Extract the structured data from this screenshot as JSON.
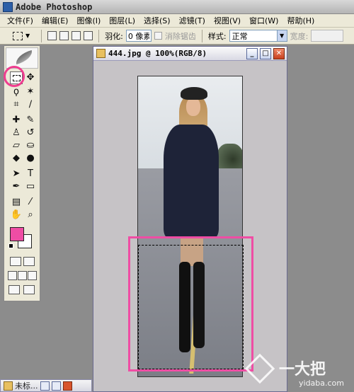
{
  "app": {
    "title": "Adobe Photoshop"
  },
  "menu": [
    {
      "label": "文件(F)"
    },
    {
      "label": "编辑(E)"
    },
    {
      "label": "图像(I)"
    },
    {
      "label": "图层(L)"
    },
    {
      "label": "选择(S)"
    },
    {
      "label": "滤镜(T)"
    },
    {
      "label": "视图(V)"
    },
    {
      "label": "窗口(W)"
    },
    {
      "label": "帮助(H)"
    }
  ],
  "options": {
    "feather_label": "羽化:",
    "feather_value": "0 像素",
    "antialias_label": "消除锯齿",
    "style_label": "样式:",
    "style_value": "正常",
    "width_label": "宽度:"
  },
  "toolbox": {
    "tools": [
      {
        "icon": "rect-marquee-icon",
        "glyph": ""
      },
      {
        "icon": "move-icon",
        "glyph": "✥"
      },
      {
        "icon": "lasso-icon",
        "glyph": "ϙ"
      },
      {
        "icon": "magic-wand-icon",
        "glyph": "✶"
      },
      {
        "icon": "crop-icon",
        "glyph": "⌗"
      },
      {
        "icon": "slice-icon",
        "glyph": "∕"
      },
      {
        "icon": "healing-brush-icon",
        "glyph": "✚"
      },
      {
        "icon": "brush-icon",
        "glyph": "✎"
      },
      {
        "icon": "clone-stamp-icon",
        "glyph": "♙"
      },
      {
        "icon": "history-brush-icon",
        "glyph": "↺"
      },
      {
        "icon": "eraser-icon",
        "glyph": "▱"
      },
      {
        "icon": "paint-bucket-icon",
        "glyph": "⛀"
      },
      {
        "icon": "blur-icon",
        "glyph": "◆"
      },
      {
        "icon": "dodge-icon",
        "glyph": "●"
      },
      {
        "icon": "path-select-icon",
        "glyph": "➤"
      },
      {
        "icon": "type-icon",
        "glyph": "T"
      },
      {
        "icon": "pen-icon",
        "glyph": "✒"
      },
      {
        "icon": "shape-icon",
        "glyph": "▭"
      },
      {
        "icon": "notes-icon",
        "glyph": "▤"
      },
      {
        "icon": "eyedropper-icon",
        "glyph": "⁄"
      },
      {
        "icon": "hand-icon",
        "glyph": "✋"
      },
      {
        "icon": "zoom-icon",
        "glyph": "⌕"
      }
    ],
    "foreground_color": "#ef4da4",
    "background_color": "#ffffff"
  },
  "document": {
    "title": "444.jpg @ 100%(RGB/8)",
    "win_min": "_",
    "win_max": "□",
    "win_close": "✕"
  },
  "minimized": {
    "title": "未标..."
  },
  "watermark": {
    "brand": "一大把",
    "url": "yidaba.com"
  },
  "highlight_color": "#ef4da4"
}
